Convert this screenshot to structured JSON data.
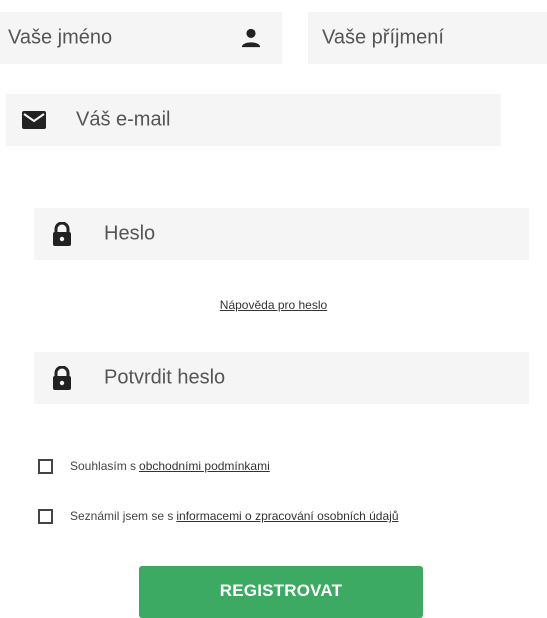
{
  "form": {
    "first_name": {
      "placeholder": "Vaše jméno",
      "icon": "person-icon"
    },
    "last_name": {
      "placeholder": "Vaše příjmení"
    },
    "email": {
      "placeholder": "Váš e-mail",
      "icon": "envelope-icon"
    },
    "password": {
      "placeholder": "Heslo",
      "icon": "lock-icon"
    },
    "password_help": "Nápověda pro heslo",
    "confirm_password": {
      "placeholder": "Potvrdit heslo",
      "icon": "lock-icon"
    },
    "terms": {
      "prefix": "Souhlasím s ",
      "link": "obchodními podmínkami"
    },
    "privacy": {
      "prefix": "Seznámil jsem se s ",
      "link": "informacemi o zpracování osobních údajů"
    },
    "submit_label": "REGISTROVAT"
  },
  "colors": {
    "field_bg": "#f5f5f5",
    "button_bg": "#3daa63",
    "icon": "#222222"
  }
}
